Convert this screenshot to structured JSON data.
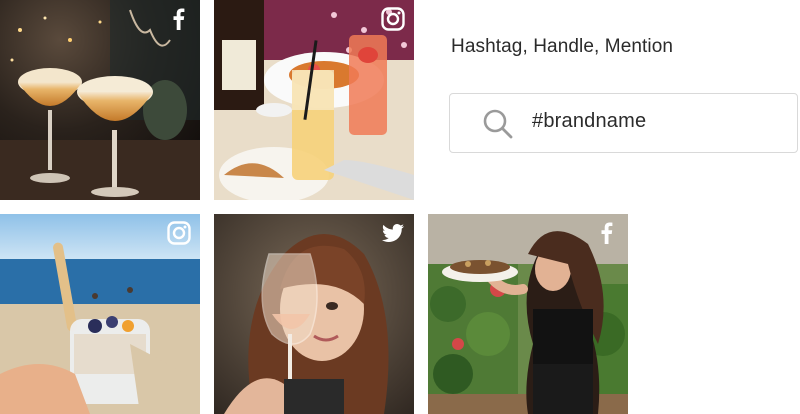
{
  "panel": {
    "title": "Hashtag, Handle, Mention",
    "search": {
      "value": "#brandname",
      "icon": "search-icon"
    }
  },
  "tiles": [
    {
      "network": "facebook",
      "icon": "facebook-icon",
      "subject": "cocktails at a restaurant bar"
    },
    {
      "network": "instagram",
      "icon": "instagram-icon",
      "subject": "drinks and dinner table"
    },
    {
      "network": "instagram",
      "icon": "instagram-icon",
      "subject": "parfait jar at the beach"
    },
    {
      "network": "twitter",
      "icon": "twitter-icon",
      "subject": "woman raising a glass of rosé"
    },
    {
      "network": "facebook",
      "icon": "facebook-icon",
      "subject": "woman holding a plate in a garden"
    }
  ],
  "colors": {
    "badge": "#ffffff",
    "text": "#2b2b2b",
    "border": "#d9d9d9"
  }
}
